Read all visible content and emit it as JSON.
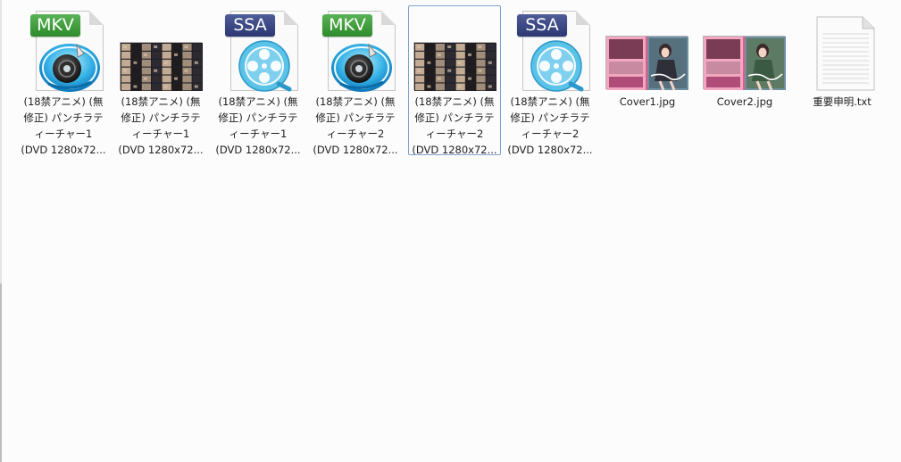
{
  "files": [
    {
      "name": "(18禁アニメ) (無\n修正) パンチラテ\nィーチャー1\n(DVD 1280x72...",
      "type": "mkv",
      "ext_label": "MKV",
      "icon": "mkv-video-icon",
      "selected": false
    },
    {
      "name": "(18禁アニメ) (無\n修正) パンチラテ\nィーチャー1\n(DVD 1280x72...",
      "type": "thumbnail",
      "ext_label": "",
      "icon": "video-thumbnail",
      "selected": false
    },
    {
      "name": "(18禁アニメ) (無\n修正) パンチラテ\nィーチャー1\n(DVD 1280x72...",
      "type": "ssa",
      "ext_label": "SSA",
      "icon": "ssa-subtitle-icon",
      "selected": false
    },
    {
      "name": "(18禁アニメ) (無\n修正) パンチラテ\nィーチャー2\n(DVD 1280x72...",
      "type": "mkv",
      "ext_label": "MKV",
      "icon": "mkv-video-icon",
      "selected": false
    },
    {
      "name": "(18禁アニメ) (無\n修正) パンチラテ\nィーチャー2\n(DVD 1280x72...",
      "type": "thumbnail",
      "ext_label": "",
      "icon": "video-thumbnail",
      "selected": true
    },
    {
      "name": "(18禁アニメ) (無\n修正) パンチラテ\nィーチャー2\n(DVD 1280x72...",
      "type": "ssa",
      "ext_label": "SSA",
      "icon": "ssa-subtitle-icon",
      "selected": false
    },
    {
      "name": "Cover1.jpg",
      "type": "cover",
      "ext_label": "",
      "icon": "jpg-image-thumbnail",
      "selected": false
    },
    {
      "name": "Cover2.jpg",
      "type": "cover",
      "ext_label": "",
      "icon": "jpg-image-thumbnail",
      "selected": false
    },
    {
      "name": "重要申明.txt",
      "type": "txt",
      "ext_label": "",
      "icon": "text-document-icon",
      "selected": false
    }
  ],
  "colors": {
    "mkv_badge": "#3f9b3c",
    "ssa_badge": "#3a4784",
    "reel_blue": "#5ec4ea",
    "selection_border": "#7da2ce"
  }
}
